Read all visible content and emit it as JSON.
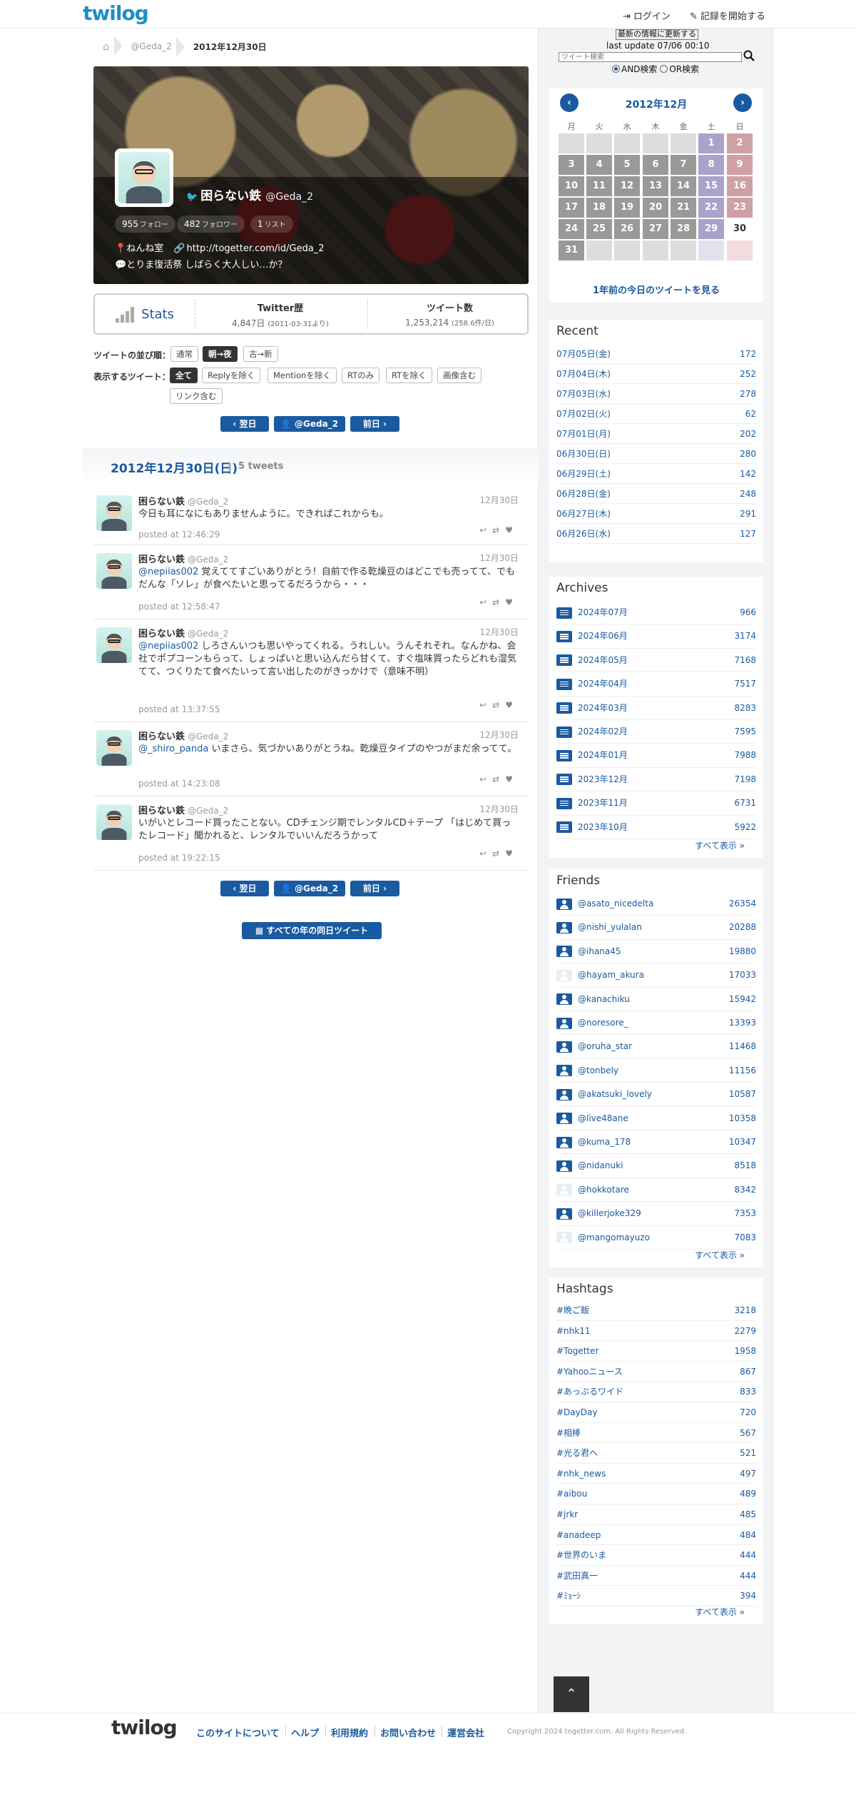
{
  "header": {
    "logo": "twilog",
    "login": "ログイン",
    "start_recording": "記録を開始する"
  },
  "breadcrumb": {
    "user": "@Geda_2",
    "current": "2012年12月30日"
  },
  "profile": {
    "name": "困らない鉄",
    "handle": "@Geda_2",
    "followers_count": "955",
    "followers_label": "フォロー",
    "following_count": "482",
    "following_label": "フォロワー",
    "lists_count": "1",
    "lists_label": "リスト",
    "location": "ねんね室",
    "url": "http://togetter.com/id/Geda_2",
    "description": "とりま復活祭 しばらく大人しい…か？"
  },
  "stats": {
    "label": "Stats",
    "history_title": "Twitter歴",
    "history_value": "4,847日",
    "history_note": "(2011-03-31より)",
    "tweets_title": "ツイート数",
    "tweets_value": "1,253,214",
    "tweets_note": "(258.6件/日)"
  },
  "sort": {
    "label": "ツイートの並び順：",
    "options": [
      "通常",
      "朝→夜",
      "古→新"
    ],
    "active": "朝→夜"
  },
  "filter": {
    "label": "表示するツイート：",
    "options": [
      "全て",
      "Replyを除く",
      "Mentionを除く",
      "RTのみ",
      "RTを除く",
      "画像含む",
      "リンク含む"
    ],
    "active": "全て"
  },
  "nav": {
    "next_day": "翌日",
    "user": "@Geda_2",
    "prev_day": "前日"
  },
  "date_heading": {
    "date": "2012年12月30日(日)",
    "count": "5 tweets"
  },
  "tweets": [
    {
      "name": "困らない鉄",
      "handle": "@Geda_2",
      "date": "12月30日",
      "text": "今日も耳になにもありませんように。できればこれからも。",
      "time": "posted at 12:46:29"
    },
    {
      "name": "困らない鉄",
      "handle": "@Geda_2",
      "date": "12月30日",
      "mention": "@nepiias002",
      "text": " 覚えててすごいありがとう！自前で作る乾燥豆のはどこでも売ってて、でもだんな「ソレ」が食べたいと思ってるだろうから・・・",
      "time": "posted at 12:58:47"
    },
    {
      "name": "困らない鉄",
      "handle": "@Geda_2",
      "date": "12月30日",
      "mention": "@nepiias002",
      "text": " しろさんいつも思いやってくれる。うれしい。うんそれそれ。なんかね、会社でポプコーンもらって、しょっぱいと思い込んだら甘くて、すぐ塩味買ったらどれも湿気てて、つくりたて食べたいって言い出したのがきっかけで（意味不明）",
      "time": "posted at 13:37:55"
    },
    {
      "name": "困らない鉄",
      "handle": "@Geda_2",
      "date": "12月30日",
      "mention": "@_shiro_panda",
      "text": " いまさら、気づかいありがとうね。乾燥豆タイプのやつがまだ余ってて。",
      "time": "posted at 14:23:08"
    },
    {
      "name": "困らない鉄",
      "handle": "@Geda_2",
      "date": "12月30日",
      "text": "いがいとレコード買ったことない。CDチェンジ期でレンタルCD＋テープ 「はじめて買ったレコード」聞かれると、レンタルでいいんだろうかって",
      "time": "posted at 19:22:15"
    }
  ],
  "all_years_button": "すべての年の同日ツイート",
  "sidebar": {
    "update_button": "最新の情報に更新する",
    "last_update": "last update 07/06 00:10",
    "search_placeholder": "ツイート検索",
    "and_search": "AND検索",
    "or_search": "OR検索",
    "calendar": {
      "title": "2012年12月",
      "prev": "‹",
      "next": "›",
      "weekdays": [
        "月",
        "火",
        "水",
        "木",
        "金",
        "土",
        "日"
      ],
      "last_year_link": "1年前の今日のツイートを見る"
    },
    "recent": {
      "title": "Recent",
      "items": [
        {
          "label": "07月05日(金)",
          "count": "172"
        },
        {
          "label": "07月04日(木)",
          "count": "252"
        },
        {
          "label": "07月03日(水)",
          "count": "278"
        },
        {
          "label": "07月02日(火)",
          "count": "62"
        },
        {
          "label": "07月01日(月)",
          "count": "202"
        },
        {
          "label": "06月30日(日)",
          "count": "280"
        },
        {
          "label": "06月29日(土)",
          "count": "142"
        },
        {
          "label": "06月28日(金)",
          "count": "248"
        },
        {
          "label": "06月27日(木)",
          "count": "291"
        },
        {
          "label": "06月26日(水)",
          "count": "127"
        }
      ]
    },
    "archives": {
      "title": "Archives",
      "more": "すべて表示 »",
      "items": [
        {
          "label": "2024年07月",
          "count": "966"
        },
        {
          "label": "2024年06月",
          "count": "3174"
        },
        {
          "label": "2024年05月",
          "count": "7168"
        },
        {
          "label": "2024年04月",
          "count": "7517"
        },
        {
          "label": "2024年03月",
          "count": "8283"
        },
        {
          "label": "2024年02月",
          "count": "7595"
        },
        {
          "label": "2024年01月",
          "count": "7988"
        },
        {
          "label": "2023年12月",
          "count": "7198"
        },
        {
          "label": "2023年11月",
          "count": "6731"
        },
        {
          "label": "2023年10月",
          "count": "5922"
        }
      ]
    },
    "friends": {
      "title": "Friends",
      "more": "すべて表示 »",
      "items": [
        {
          "label": "@asato_nicedelta",
          "count": "26354"
        },
        {
          "label": "@nishi_yulalan",
          "count": "20288"
        },
        {
          "label": "@ihana45",
          "count": "19880"
        },
        {
          "label": "@hayam_akura",
          "count": "17033"
        },
        {
          "label": "@kanachiku",
          "count": "15942"
        },
        {
          "label": "@noresore_",
          "count": "13393"
        },
        {
          "label": "@oruha_star",
          "count": "11468"
        },
        {
          "label": "@tonbely",
          "count": "11156"
        },
        {
          "label": "@akatsuki_lovely",
          "count": "10587"
        },
        {
          "label": "@live48ane",
          "count": "10358"
        },
        {
          "label": "@kuma_178",
          "count": "10347"
        },
        {
          "label": "@nidanuki",
          "count": "8518"
        },
        {
          "label": "@hokkotare",
          "count": "8342"
        },
        {
          "label": "@killerjoke329",
          "count": "7353"
        },
        {
          "label": "@mangomayuzo",
          "count": "7083"
        }
      ]
    },
    "hashtags": {
      "title": "Hashtags",
      "more": "すべて表示 »",
      "items": [
        {
          "label": "#晩ご飯",
          "count": "3218"
        },
        {
          "label": "#nhk11",
          "count": "2279"
        },
        {
          "label": "#Togetter",
          "count": "1958"
        },
        {
          "label": "#Yahooニュース",
          "count": "867"
        },
        {
          "label": "#あっぷるワイド",
          "count": "833"
        },
        {
          "label": "#DayDay",
          "count": "720"
        },
        {
          "label": "#相棒",
          "count": "567"
        },
        {
          "label": "#光る君へ",
          "count": "521"
        },
        {
          "label": "#nhk_news",
          "count": "497"
        },
        {
          "label": "#aibou",
          "count": "489"
        },
        {
          "label": "#jrkr",
          "count": "485"
        },
        {
          "label": "#anadeep",
          "count": "484"
        },
        {
          "label": "#世界のいま",
          "count": "444"
        },
        {
          "label": "#武田真一",
          "count": "444"
        },
        {
          "label": "#ﾐｮｰｼ",
          "count": "394"
        }
      ]
    }
  },
  "footer": {
    "logo": "twilog",
    "links": [
      "このサイトについて",
      "ヘルプ",
      "利用規約",
      "お問い合わせ",
      "運営会社"
    ],
    "copyright": "Copyright 2024 togetter.com. All Rights Reserved."
  },
  "colors": {
    "brand": "#1e8fc4",
    "link": "#1a5aa0",
    "saturday": "#a9a3cc",
    "sunday": "#d0a0a4"
  }
}
